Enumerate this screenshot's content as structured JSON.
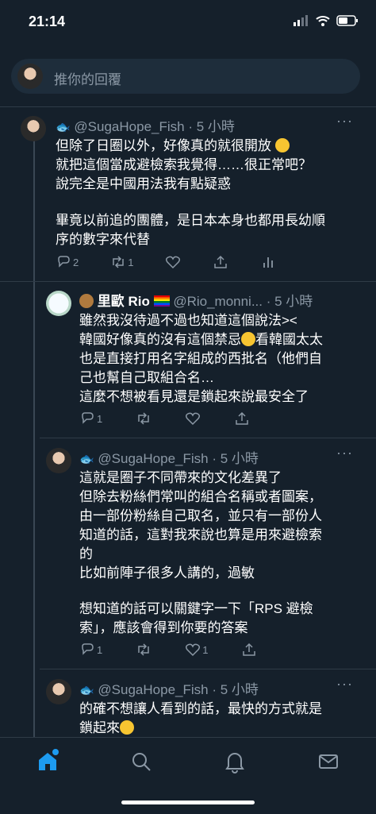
{
  "status": {
    "time": "21:14"
  },
  "reply": {
    "placeholder": "推你的回覆"
  },
  "tweets": [
    {
      "display_name": "",
      "handle": "@SugaHope_Fish",
      "time": "· 5 小時",
      "lines": [
        "但除了日圈以外，好像真的就很開放",
        "就把這個當成避檢索我覺得……很正常吧？",
        "說完全是中國用法我有點疑惑",
        "",
        "畢竟以前追的團體，是日本本身也都用長幼順",
        "序的數字來代替"
      ],
      "reply_count": "2",
      "retweet_count": "1",
      "like_count": ""
    },
    {
      "display_name": "里歐 Rio",
      "handle": "@Rio_monni...",
      "time": "· 5 小時",
      "lines": [
        "雖然我沒待過不過也知道這個說法><",
        "韓國好像真的沒有這個禁忌",
        "看韓國太太",
        "也是直接打用名字組成的西批名（他們自",
        "己也幫自己取組合名…",
        "這麼不想被看見還是鎖起來說最安全了"
      ],
      "reply_count": "1",
      "retweet_count": "",
      "like_count": ""
    },
    {
      "display_name": "",
      "handle": "@SugaHope_Fish",
      "time": "· 5 小時",
      "lines": [
        "這就是圈子不同帶來的文化差異了",
        "但除去粉絲們常叫的組合名稱或者圖案，",
        "由一部份粉絲自己取名，並只有一部份人",
        "知道的話，這對我來說也算是用來避檢索",
        "的",
        "比如前陣子很多人講的，過敏",
        "",
        "想知道的話可以關鍵字一下「RPS 避檢",
        "索」，應該會得到你要的答案"
      ],
      "reply_count": "1",
      "retweet_count": "",
      "like_count": "1"
    },
    {
      "display_name": "",
      "handle": "@SugaHope_Fish",
      "time": "· 5 小時",
      "lines": [
        "的確不想讓人看到的話，最快的方式就是",
        "鎖起來"
      ]
    }
  ],
  "icons": {
    "more": "more-dots-icon",
    "reply": "reply-icon",
    "retweet": "retweet-icon",
    "like": "heart-icon",
    "share": "share-icon",
    "analytics": "analytics-icon"
  },
  "tabs": [
    "home-icon",
    "search-icon",
    "notifications-icon",
    "messages-icon"
  ],
  "colors": {
    "background": "#15202b",
    "accent": "#1d9bf0",
    "muted": "#8b98a5"
  }
}
